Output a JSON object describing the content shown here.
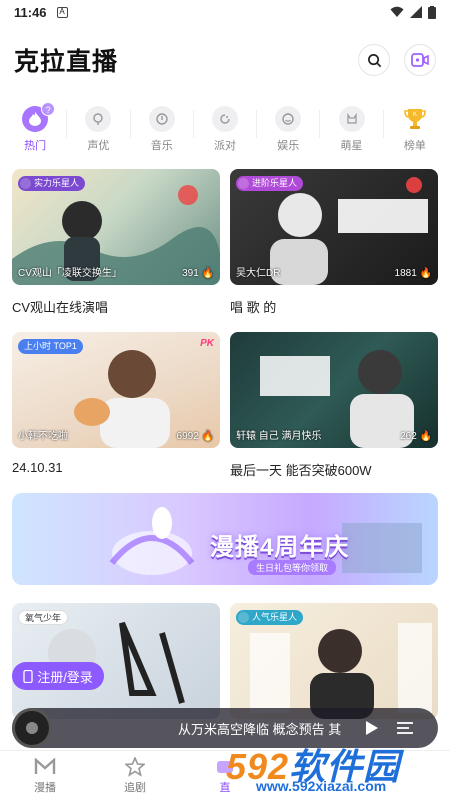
{
  "status_bar": {
    "time": "11:46"
  },
  "header": {
    "title": "克拉直播"
  },
  "categories": [
    {
      "label": "热门",
      "active": true
    },
    {
      "label": "声优"
    },
    {
      "label": "音乐"
    },
    {
      "label": "派对"
    },
    {
      "label": "娱乐"
    },
    {
      "label": "萌星"
    },
    {
      "label": "榜单"
    }
  ],
  "cards": [
    {
      "badge": "实力乐星人",
      "overlay_name": "CV观山「凌联交换生」",
      "count": "391",
      "title": "CV观山在线演唱"
    },
    {
      "badge": "进阶乐星人",
      "overlay_name": "吴大仁DR",
      "count": "1881",
      "title": "唱 歌 的"
    },
    {
      "badge": "上小时 TOP1",
      "overlay_name": "小韩不吃啦",
      "count": "6992",
      "title": "24.10.31",
      "corner": "PK"
    },
    {
      "badge": "",
      "overlay_name": "轩辕 自己 满月快乐",
      "count": "262",
      "title": "最后一天 能否突破600W"
    },
    {
      "badge": "氧气少年",
      "overlay_name": ""
    },
    {
      "badge": "人气乐星人",
      "overlay_name": ""
    }
  ],
  "banner": {
    "title": "漫播4周年庆",
    "subtitle": "生日礼包等你领取"
  },
  "login_button": "注册/登录",
  "player": {
    "song": "从万米高空降临 概念预告 其"
  },
  "bottom_nav": [
    {
      "label": "漫播"
    },
    {
      "label": "追剧"
    },
    {
      "label": "直",
      "active": true
    },
    {
      "label": ""
    },
    {
      "label": ""
    }
  ],
  "watermark": {
    "number": "592",
    "cn": "软件园",
    "url": "www.592xiazai.com"
  },
  "colors": {
    "accent": "#8a4dff",
    "watermark_orange": "#f08a1e",
    "watermark_blue": "#1e6fd9"
  }
}
